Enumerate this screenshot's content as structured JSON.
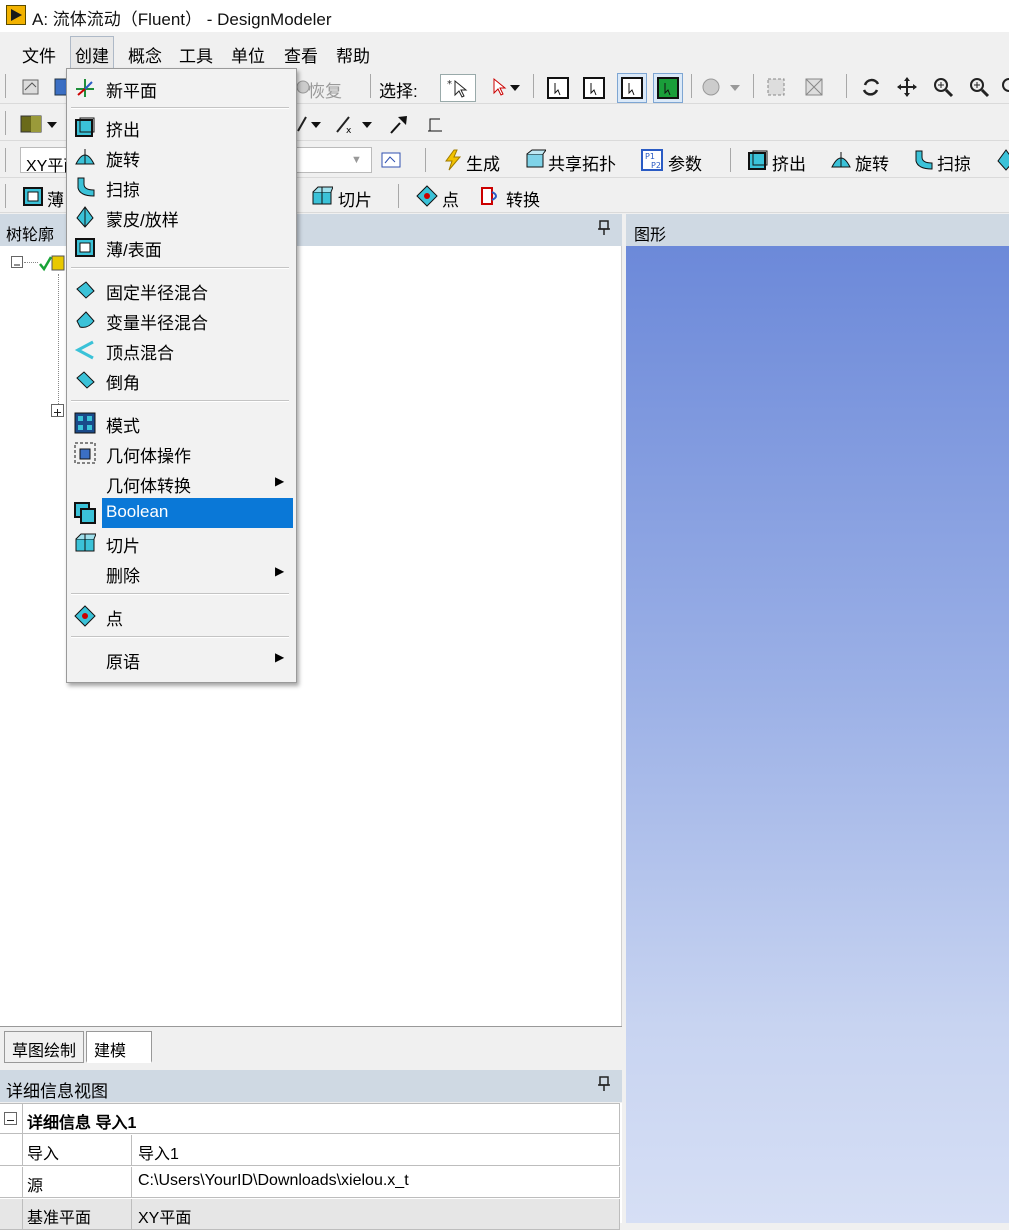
{
  "window": {
    "title": "A: 流体流动（Fluent） - DesignModeler"
  },
  "menubar": {
    "items": [
      {
        "id": "file",
        "label": "文件"
      },
      {
        "id": "create",
        "label": "创建"
      },
      {
        "id": "concept",
        "label": "概念"
      },
      {
        "id": "tools",
        "label": "工具"
      },
      {
        "id": "units",
        "label": "单位"
      },
      {
        "id": "view",
        "label": "查看"
      },
      {
        "id": "help",
        "label": "帮助"
      }
    ]
  },
  "toolbar1": {
    "restore_label": "恢复",
    "select_label": "选择:"
  },
  "toolbar3": {
    "plane_combo_value": "XY平面",
    "generate_label": "生成",
    "share_topology_label": "共享拓扑",
    "parameters_label": "参数",
    "extrude_label": "挤出",
    "revolve_label": "旋转",
    "sweep_label": "扫掠"
  },
  "toolbar4": {
    "thin_label": "薄",
    "slice_label": "切片",
    "point_label": "点",
    "convert_label": "转换"
  },
  "tree_panel": {
    "title": "树轮廓",
    "pin": "📌"
  },
  "graphics_panel": {
    "title": "图形"
  },
  "mode_tabs": {
    "sketching": "草图绘制",
    "modeling": "建模"
  },
  "details": {
    "title": "详细信息视图",
    "section_title": "详细信息 导入1",
    "rows": [
      {
        "key": "导入",
        "value": "导入1"
      },
      {
        "key": "源",
        "value": "C:\\Users\\YourID\\Downloads\\xielou.x_t"
      },
      {
        "key": "基准平面",
        "value": "XY平面"
      }
    ]
  },
  "create_menu": {
    "items": [
      {
        "label": "新平面",
        "icon": "new-plane-icon"
      },
      {
        "label": "挤出",
        "icon": "extrude-icon"
      },
      {
        "label": "旋转",
        "icon": "revolve-icon"
      },
      {
        "label": "扫掠",
        "icon": "sweep-icon"
      },
      {
        "label": "蒙皮/放样",
        "icon": "skin-loft-icon"
      },
      {
        "label": "薄/表面",
        "icon": "thin-surface-icon"
      },
      {
        "label": "固定半径混合",
        "icon": "fixed-radius-blend-icon"
      },
      {
        "label": "变量半径混合",
        "icon": "variable-radius-blend-icon"
      },
      {
        "label": "顶点混合",
        "icon": "vertex-blend-icon"
      },
      {
        "label": "倒角",
        "icon": "chamfer-icon"
      },
      {
        "label": "模式",
        "icon": "pattern-icon"
      },
      {
        "label": "几何体操作",
        "icon": "body-operation-icon"
      },
      {
        "label": "几何体转换",
        "icon": "",
        "submenu": true
      },
      {
        "label": "Boolean",
        "icon": "boolean-icon",
        "selected": true
      },
      {
        "label": "切片",
        "icon": "slice-icon"
      },
      {
        "label": "删除",
        "icon": "",
        "submenu": true
      },
      {
        "label": "点",
        "icon": "point-icon"
      },
      {
        "label": "原语",
        "icon": "",
        "submenu": true
      }
    ],
    "submenu_arrow": "▶"
  },
  "colors": {
    "selection": "#0a78d7",
    "panel_header": "#cfd9e3",
    "graphics_top": "#6c89d9",
    "graphics_bottom": "#d6dff5"
  }
}
